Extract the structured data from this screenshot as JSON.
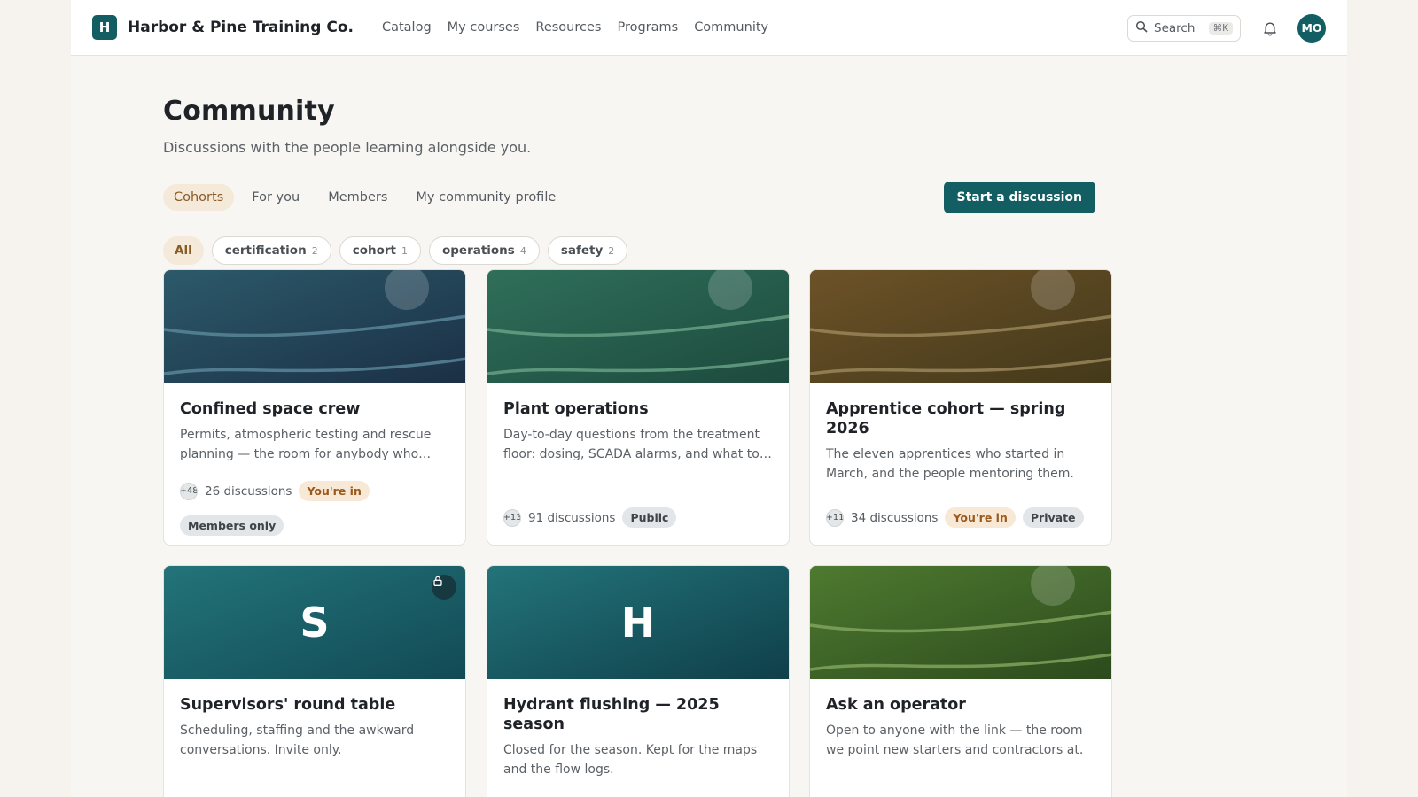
{
  "header": {
    "logo_letter": "H",
    "brand": "Harbor & Pine Training Co.",
    "nav": [
      "Catalog",
      "My courses",
      "Resources",
      "Programs",
      "Community"
    ],
    "search_label": "Search",
    "search_shortcut": "⌘K",
    "avatar_initials": "MO"
  },
  "page": {
    "title": "Community",
    "subtitle": "Discussions with the people learning alongside you."
  },
  "tabs": [
    {
      "label": "Cohorts",
      "active": true
    },
    {
      "label": "For you",
      "active": false
    },
    {
      "label": "Members",
      "active": false
    },
    {
      "label": "My community profile",
      "active": false
    }
  ],
  "start_button": "Start a discussion",
  "filters": [
    {
      "label": "All",
      "count": "",
      "active": true
    },
    {
      "label": "certification",
      "count": "2",
      "active": false
    },
    {
      "label": "cohort",
      "count": "1",
      "active": false
    },
    {
      "label": "operations",
      "count": "4",
      "active": false
    },
    {
      "label": "safety",
      "count": "2",
      "active": false
    }
  ],
  "cards": [
    {
      "title": "Confined space crew",
      "description": "Permits, atmospheric testing and rescue planning — the room for anybody who works below grade or in tanks.",
      "avatars": "+48",
      "discussions": "26 discussions",
      "badges": [
        {
          "text": "You're in",
          "kind": "in"
        },
        {
          "text": "Members only",
          "kind": "vis"
        }
      ],
      "cover": {
        "from": "#2c5a6a",
        "to": "#1b2f45",
        "wave": "#5d8a9c",
        "letter": "",
        "lock": false
      }
    },
    {
      "title": "Plant operations",
      "description": "Day-to-day questions from the treatment floor: dosing, SCADA alarms, and what to do when the numbers drift.",
      "avatars": "+13",
      "discussions": "91 discussions",
      "badges": [
        {
          "text": "Public",
          "kind": "vis"
        }
      ],
      "cover": {
        "from": "#2f6f5a",
        "to": "#1d4a3d",
        "wave": "#6aa58a",
        "letter": "",
        "lock": false
      }
    },
    {
      "title": "Apprentice cohort — spring 2026",
      "description": "The eleven apprentices who started in March, and the people mentoring them.",
      "avatars": "+11",
      "discussions": "34 discussions",
      "badges": [
        {
          "text": "You're in",
          "kind": "in"
        },
        {
          "text": "Private",
          "kind": "vis"
        }
      ],
      "cover": {
        "from": "#6d5228",
        "to": "#43391a",
        "wave": "#9e8a5e",
        "letter": "",
        "lock": false
      }
    },
    {
      "title": "Supervisors' round table",
      "description": "Scheduling, staffing and the awkward conversations. Invite only.",
      "avatars": "",
      "discussions": "",
      "badges": [],
      "cover": {
        "from": "#23747a",
        "to": "#124a55",
        "wave": "",
        "letter": "S",
        "lock": true
      }
    },
    {
      "title": "Hydrant flushing — 2025 season",
      "description": "Closed for the season. Kept for the maps and the flow logs.",
      "avatars": "",
      "discussions": "",
      "badges": [],
      "cover": {
        "from": "#23747a",
        "to": "#0f3f4a",
        "wave": "",
        "letter": "H",
        "lock": false
      }
    },
    {
      "title": "Ask an operator",
      "description": "Open to anyone with the link — the room we point new starters and contractors at.",
      "avatars": "",
      "discussions": "",
      "badges": [],
      "cover": {
        "from": "#4e7a30",
        "to": "#2c4a1c",
        "wave": "#84a862",
        "letter": "",
        "lock": false
      }
    }
  ]
}
